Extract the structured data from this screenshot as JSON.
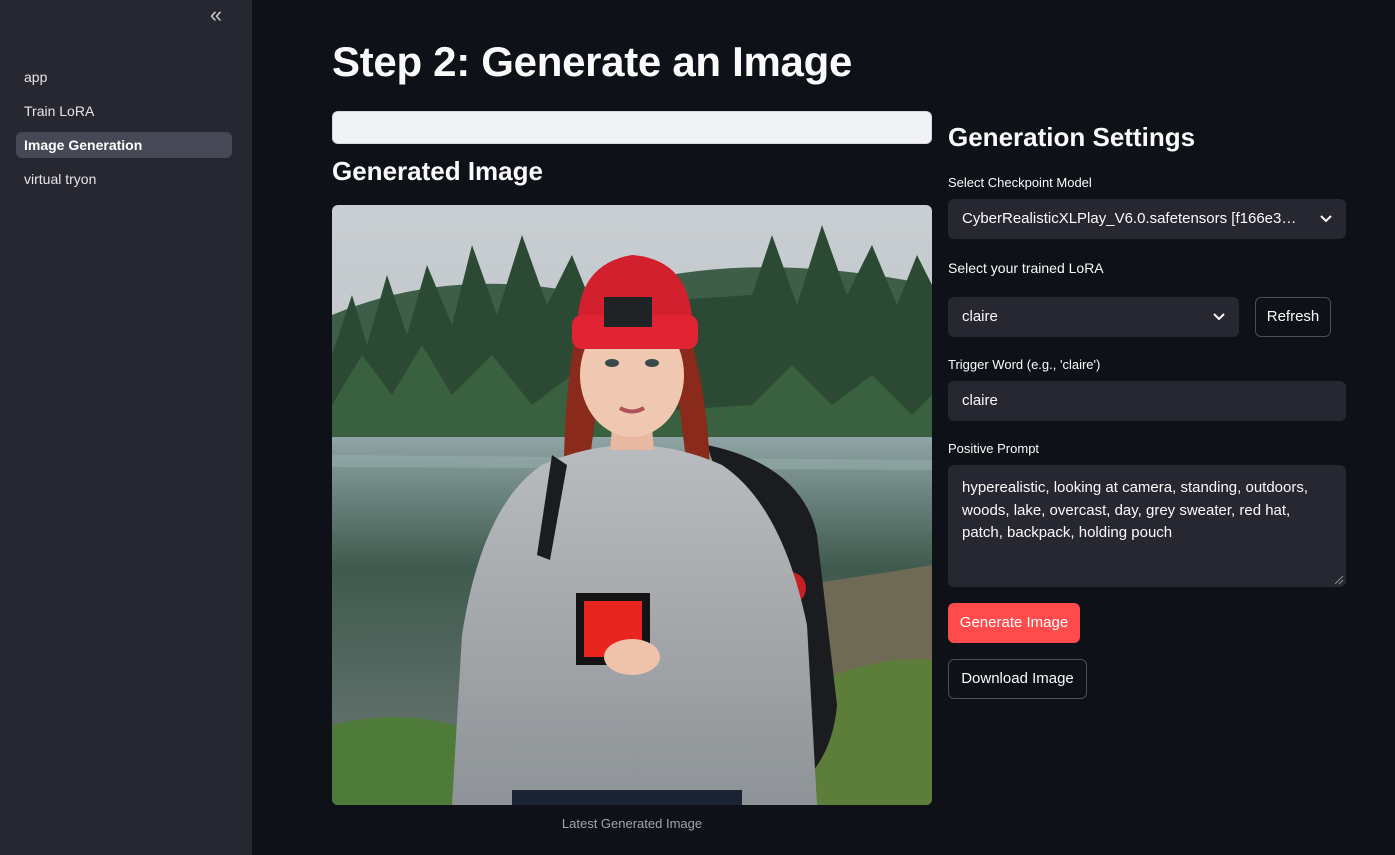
{
  "sidebar": {
    "collapse_glyph": "«",
    "items": [
      {
        "label": "app"
      },
      {
        "label": "Train LoRA"
      },
      {
        "label": "Image Generation"
      },
      {
        "label": "virtual tryon"
      }
    ],
    "active_index": 2
  },
  "main": {
    "title": "Step 2: Generate an Image",
    "generated_heading": "Generated Image",
    "image_caption": "Latest Generated Image"
  },
  "settings": {
    "heading": "Generation Settings",
    "checkpoint_label": "Select Checkpoint Model",
    "checkpoint_value": "CyberRealisticXLPlay_V6.0.safetensors [f166e3d…",
    "lora_label": "Select your trained LoRA",
    "lora_value": "claire",
    "refresh_label": "Refresh",
    "trigger_label": "Trigger Word (e.g., 'claire')",
    "trigger_value": "claire",
    "prompt_label": "Positive Prompt",
    "prompt_value": "hyperealistic, looking  at camera, standing, outdoors, woods, lake, overcast, day,  grey sweater, red hat, patch, backpack, holding pouch",
    "generate_label": "Generate Image",
    "download_label": "Download Image"
  },
  "colors": {
    "background": "#0e1117",
    "sidebar": "#262730",
    "accent": "#ff4b4b",
    "input_bg": "#262730"
  }
}
